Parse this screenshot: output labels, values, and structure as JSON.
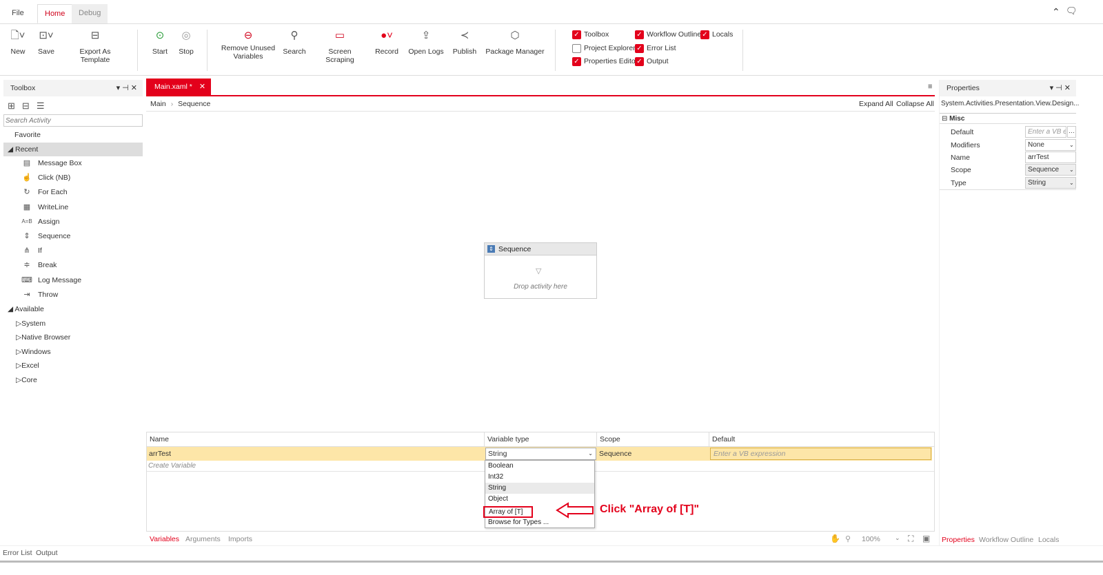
{
  "top_tabs": {
    "file": "File",
    "home": "Home",
    "debug": "Debug"
  },
  "ribbon": {
    "new": "New",
    "save": "Save",
    "export": "Export As Template",
    "start": "Start",
    "stop": "Stop",
    "remove_unused_1": "Remove Unused",
    "remove_unused_2": "Variables",
    "search": "Search",
    "screen_scraping": "Screen Scraping",
    "record": "Record",
    "open_logs": "Open Logs",
    "publish": "Publish",
    "package_manager": "Package Manager"
  },
  "panel_toggles": {
    "toolbox": "Toolbox",
    "workflow_outline": "Workflow Outline",
    "locals": "Locals",
    "project_explorer": "Project Explorer",
    "error_list": "Error List",
    "properties_editor": "Properties Editor",
    "output": "Output"
  },
  "toolbox": {
    "title": "Toolbox",
    "search_placeholder": "Search Activity",
    "favorite": "Favorite",
    "recent": "Recent",
    "recent_items": [
      "Message Box",
      "Click (NB)",
      "For Each",
      "WriteLine",
      "Assign",
      "Sequence",
      "If",
      "Break",
      "Log Message",
      "Throw"
    ],
    "available": "Available",
    "available_items": [
      "System",
      "Native Browser",
      "Windows",
      "Excel",
      "Core"
    ]
  },
  "designer": {
    "tab": "Main.xaml *",
    "breadcrumb_root": "Main",
    "breadcrumb_leaf": "Sequence",
    "expand_all": "Expand All",
    "collapse_all": "Collapse All",
    "sequence_title": "Sequence",
    "drop_hint": "Drop activity here"
  },
  "variables": {
    "headers": {
      "name": "Name",
      "type": "Variable type",
      "scope": "Scope",
      "default": "Default"
    },
    "row": {
      "name": "arrTest",
      "type": "String",
      "scope": "Sequence",
      "default_placeholder": "Enter a VB expression"
    },
    "create": "Create Variable",
    "dropdown": [
      "Boolean",
      "Int32",
      "String",
      "Object",
      "Array of [T]",
      "Browse for Types ..."
    ],
    "annotation": "Click \"Array of [T]\""
  },
  "bottom_tabs": {
    "variables": "Variables",
    "arguments": "Arguments",
    "imports": "Imports",
    "zoom": "100%"
  },
  "properties": {
    "title": "Properties",
    "type_name": "System.Activities.Presentation.View.Design...",
    "category": "Misc",
    "rows": [
      {
        "key": "Default",
        "value": "Enter a VB e"
      },
      {
        "key": "Modifiers",
        "value": "None"
      },
      {
        "key": "Name",
        "value": "arrTest"
      },
      {
        "key": "Scope",
        "value": "Sequence"
      },
      {
        "key": "Type",
        "value": "String"
      }
    ],
    "tabs": {
      "properties": "Properties",
      "workflow_outline": "Workflow Outline",
      "locals": "Locals"
    }
  },
  "statusbar": {
    "error_list": "Error List",
    "output": "Output"
  },
  "colors": {
    "accent": "#e3001b",
    "row_highlight": "#fde6a8"
  }
}
